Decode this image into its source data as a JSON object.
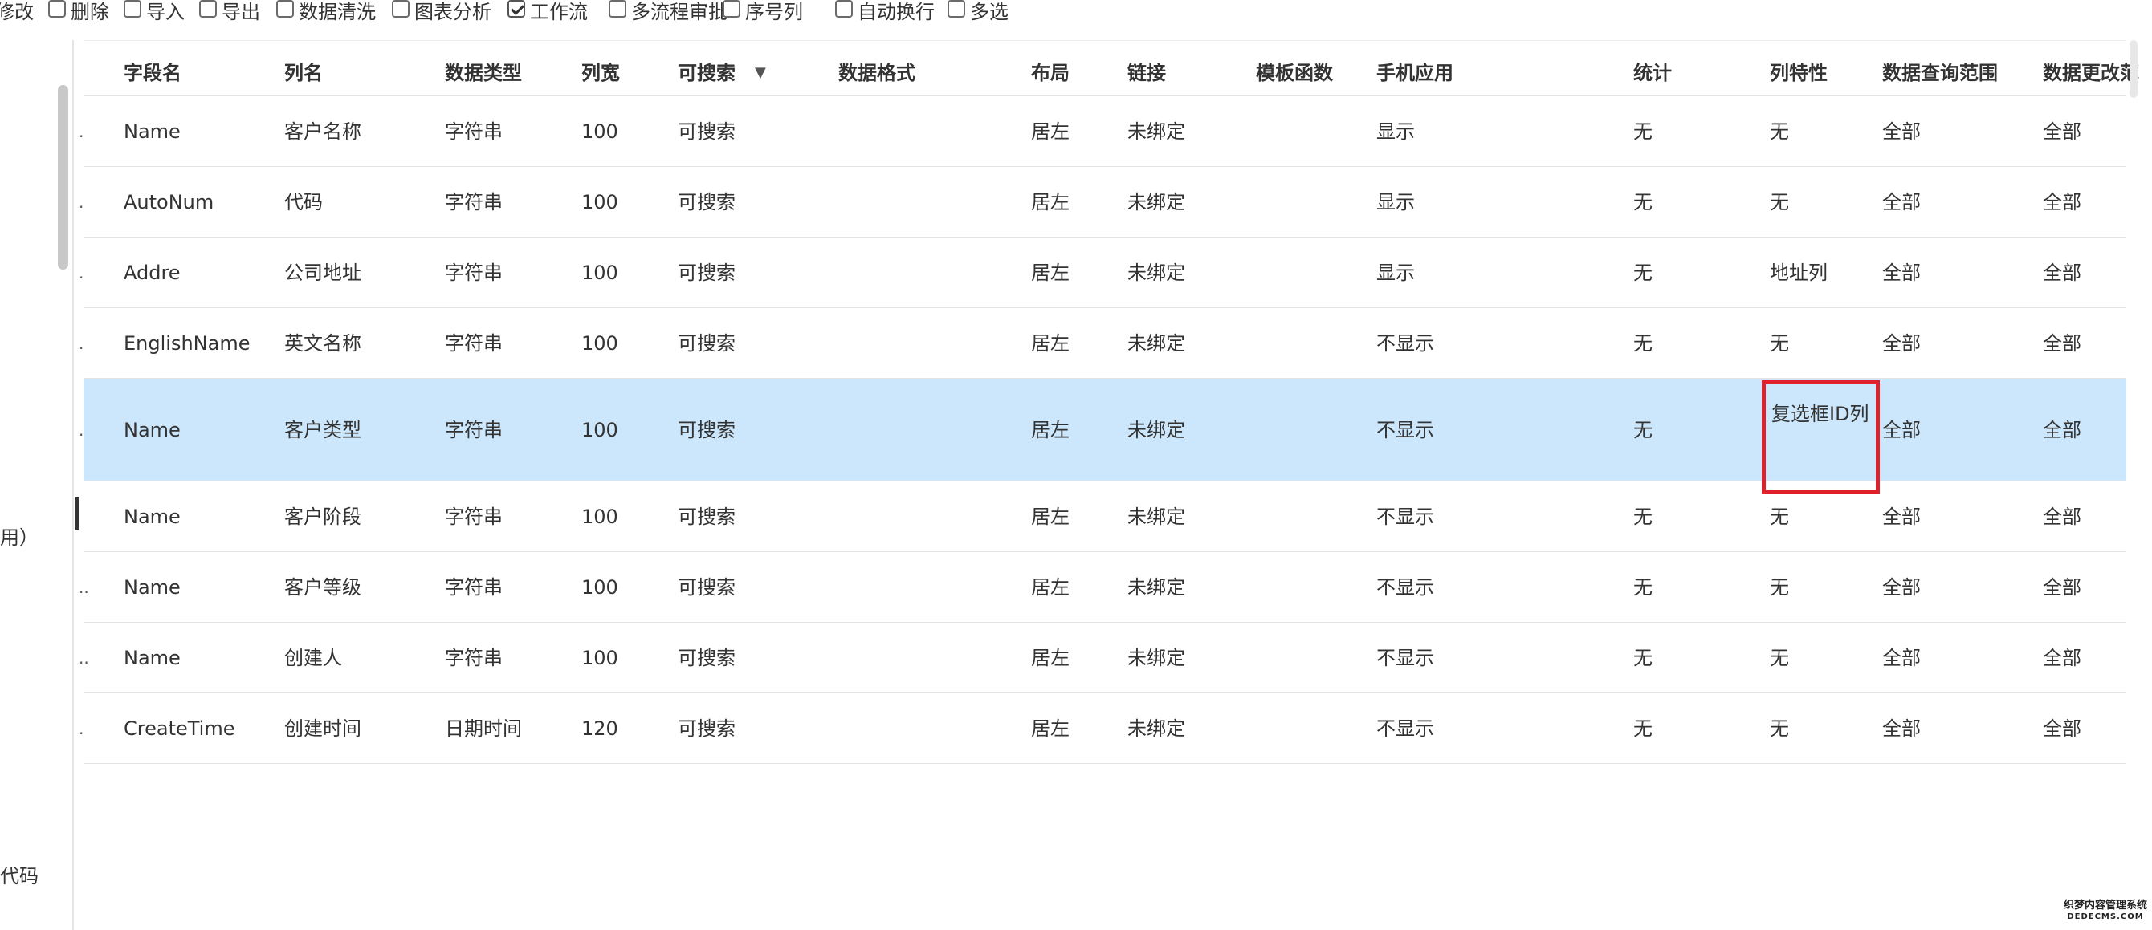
{
  "toolbar": {
    "items": [
      {
        "label": "修改",
        "has_checkbox": false,
        "checked": false
      },
      {
        "label": "删除",
        "has_checkbox": true,
        "checked": false
      },
      {
        "label": "导入",
        "has_checkbox": true,
        "checked": false
      },
      {
        "label": "导出",
        "has_checkbox": true,
        "checked": false
      },
      {
        "label": "数据清洗",
        "has_checkbox": true,
        "checked": false
      },
      {
        "label": "图表分析",
        "has_checkbox": true,
        "checked": false
      },
      {
        "label": "工作流",
        "has_checkbox": true,
        "checked": true
      },
      {
        "label": "多流程审批",
        "has_checkbox": true,
        "checked": false
      },
      {
        "label": "序号列",
        "has_checkbox": true,
        "checked": false
      },
      {
        "label": "自动换行",
        "has_checkbox": true,
        "checked": false
      },
      {
        "label": "多选",
        "has_checkbox": true,
        "checked": false
      }
    ]
  },
  "left_panel": {
    "text_1": "用）",
    "text_2": "代码"
  },
  "table": {
    "columns": [
      "字段名",
      "列名",
      "数据类型",
      "列宽",
      "可搜索",
      "数据格式",
      "布局",
      "链接",
      "模板函数",
      "手机应用",
      "统计",
      "列特性",
      "数据查询范围",
      "数据更改范"
    ],
    "sort_icon": "sort-down-triangle-icon",
    "rows": [
      {
        "mark": ".",
        "cells": [
          "Name",
          "客户名称",
          "字符串",
          "100",
          "可搜索",
          "",
          "居左",
          "未绑定",
          "",
          "显示",
          "无",
          "无",
          "全部",
          "全部"
        ],
        "selected": false
      },
      {
        "mark": ".",
        "cells": [
          "AutoNum",
          "代码",
          "字符串",
          "100",
          "可搜索",
          "",
          "居左",
          "未绑定",
          "",
          "显示",
          "无",
          "无",
          "全部",
          "全部"
        ],
        "selected": false
      },
      {
        "mark": ".",
        "cells": [
          "Addre",
          "公司地址",
          "字符串",
          "100",
          "可搜索",
          "",
          "居左",
          "未绑定",
          "",
          "显示",
          "无",
          "地址列",
          "全部",
          "全部"
        ],
        "selected": false
      },
      {
        "mark": ".",
        "cells": [
          "EnglishName",
          "英文名称",
          "字符串",
          "100",
          "可搜索",
          "",
          "居左",
          "未绑定",
          "",
          "不显示",
          "无",
          "无",
          "全部",
          "全部"
        ],
        "selected": false
      },
      {
        "mark": ".",
        "cells": [
          "Name",
          "客户类型",
          "字符串",
          "100",
          "可搜索",
          "",
          "居左",
          "未绑定",
          "",
          "不显示",
          "无",
          "复选框ID列",
          "全部",
          "全部"
        ],
        "selected": true
      },
      {
        "mark": "",
        "cells": [
          "Name",
          "客户阶段",
          "字符串",
          "100",
          "可搜索",
          "",
          "居左",
          "未绑定",
          "",
          "不显示",
          "无",
          "无",
          "全部",
          "全部"
        ],
        "selected": false
      },
      {
        "mark": "..",
        "cells": [
          "Name",
          "客户等级",
          "字符串",
          "100",
          "可搜索",
          "",
          "居左",
          "未绑定",
          "",
          "不显示",
          "无",
          "无",
          "全部",
          "全部"
        ],
        "selected": false
      },
      {
        "mark": "..",
        "cells": [
          "Name",
          "创建人",
          "字符串",
          "100",
          "可搜索",
          "",
          "居左",
          "未绑定",
          "",
          "不显示",
          "无",
          "无",
          "全部",
          "全部"
        ],
        "selected": false
      },
      {
        "mark": ".",
        "cells": [
          "CreateTime",
          "创建时间",
          "日期时间",
          "120",
          "可搜索",
          "",
          "居左",
          "未绑定",
          "",
          "不显示",
          "无",
          "无",
          "全部",
          "全部"
        ],
        "selected": false
      }
    ]
  },
  "highlight": {
    "color": "#e0202a",
    "text": "复选框ID列"
  },
  "colors": {
    "selected_row": "#cce7fb",
    "border": "#e3e3e3"
  },
  "watermark": {
    "line1": "织梦内容管理系统",
    "line2": "DEDECMS.COM"
  }
}
